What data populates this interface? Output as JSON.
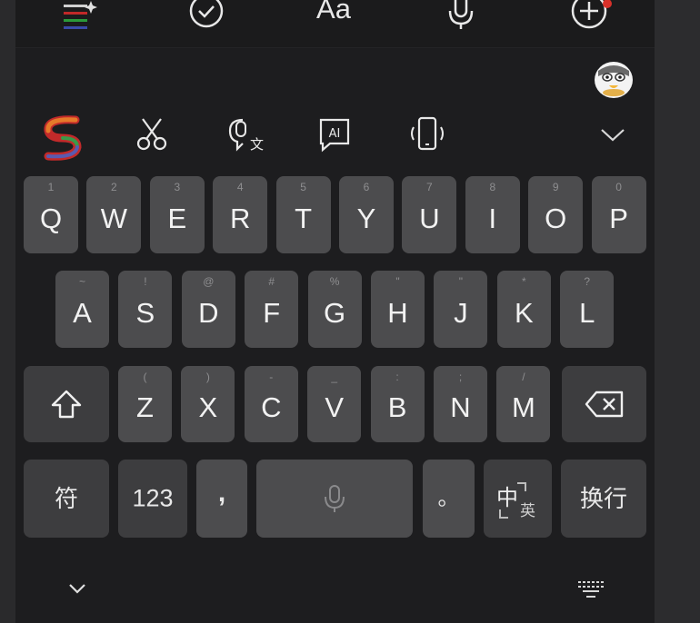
{
  "toolbar_top": {
    "icons": [
      "menu-sparkle-icon",
      "checkmark-circle-icon",
      "font-aa-icon",
      "microphone-icon",
      "add-circle-icon"
    ],
    "font_label": "Aa"
  },
  "suggestion_bar": {
    "icons": [
      "sogou-logo-icon",
      "scissors-icon",
      "voice-translate-icon",
      "ai-chat-icon",
      "phone-shake-icon",
      "chevron-down-icon",
      "mascot-avatar-icon"
    ],
    "ai_label": "AI"
  },
  "keyboard": {
    "row1": [
      {
        "letter": "Q",
        "sub": "1"
      },
      {
        "letter": "W",
        "sub": "2"
      },
      {
        "letter": "E",
        "sub": "3"
      },
      {
        "letter": "R",
        "sub": "4"
      },
      {
        "letter": "T",
        "sub": "5"
      },
      {
        "letter": "Y",
        "sub": "6"
      },
      {
        "letter": "U",
        "sub": "7"
      },
      {
        "letter": "I",
        "sub": "8"
      },
      {
        "letter": "O",
        "sub": "9"
      },
      {
        "letter": "P",
        "sub": "0"
      }
    ],
    "row2": [
      {
        "letter": "A",
        "sub": "~"
      },
      {
        "letter": "S",
        "sub": "!"
      },
      {
        "letter": "D",
        "sub": "@"
      },
      {
        "letter": "F",
        "sub": "#"
      },
      {
        "letter": "G",
        "sub": "%"
      },
      {
        "letter": "H",
        "sub": "\""
      },
      {
        "letter": "J",
        "sub": "\""
      },
      {
        "letter": "K",
        "sub": "*"
      },
      {
        "letter": "L",
        "sub": "?"
      }
    ],
    "row3": [
      {
        "letter": "Z",
        "sub": "("
      },
      {
        "letter": "X",
        "sub": ")"
      },
      {
        "letter": "C",
        "sub": "-"
      },
      {
        "letter": "V",
        "sub": "_"
      },
      {
        "letter": "B",
        "sub": ":"
      },
      {
        "letter": "N",
        "sub": ";"
      },
      {
        "letter": "M",
        "sub": "/"
      }
    ],
    "shift_icon": "shift-arrow-icon",
    "backspace_icon": "backspace-icon",
    "row4": {
      "symbols_label": "符",
      "numbers_label": "123",
      "comma_label": ",",
      "space_icon": "microphone-icon",
      "period_label": "。",
      "lang_main": "中",
      "lang_sub": "英",
      "enter_label": "换行"
    }
  },
  "bottom_bar": {
    "icons": [
      "chevron-down-icon",
      "keyboard-icon"
    ]
  }
}
